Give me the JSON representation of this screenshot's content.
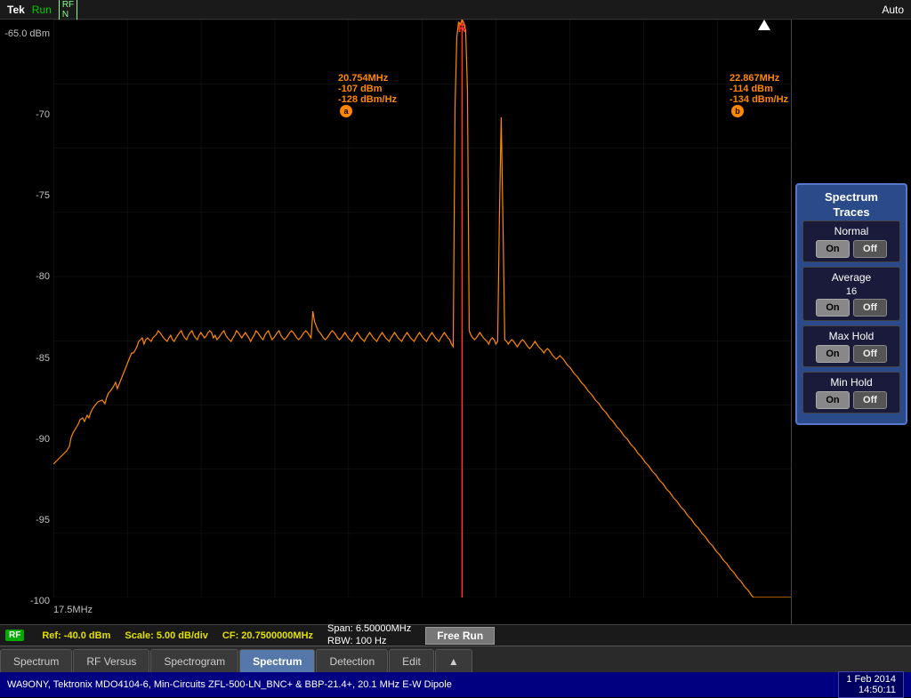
{
  "topBar": {
    "tek": "Tek",
    "run": "Run",
    "rf_n": "RF\nN",
    "auto": "Auto"
  },
  "chart": {
    "yLabels": [
      "-65.0 dBm",
      "-70",
      "-75",
      "-80",
      "-85",
      "-90",
      "-95",
      "-100"
    ],
    "xLabel": "17.5MHz",
    "markerA": {
      "freq": "20.754MHz",
      "power": "-107 dBm",
      "density": "-128 dBm/Hz",
      "label": "a"
    },
    "markerB": {
      "freq": "22.867MHz",
      "power": "-114 dBm",
      "density": "-134 dBm/Hz",
      "label": "b"
    }
  },
  "spectrumTraces": {
    "title1": "Spectrum",
    "title2": "Traces",
    "normal": {
      "label": "Normal",
      "on": "On",
      "off": "Off"
    },
    "average": {
      "label": "Average",
      "num": "16",
      "on": "On",
      "off": "Off"
    },
    "maxHold": {
      "label": "Max Hold",
      "on": "On",
      "off": "Off"
    },
    "minHold": {
      "label": "Min Hold",
      "on": "On",
      "off": "Off"
    }
  },
  "statusBar": {
    "rf": "RF",
    "ref": "Ref: -40.0 dBm",
    "scale": "Scale: 5.00 dB/div",
    "cf": "CF: 20.7500000MHz",
    "span": "Span:   6.50000MHz",
    "rbw": "RBW:    100 Hz",
    "freeRun": "Free Run"
  },
  "tabs": [
    {
      "label": "Spectrum",
      "active": false
    },
    {
      "label": "RF Versus",
      "active": false
    },
    {
      "label": "Spectrogram",
      "active": false
    },
    {
      "label": "Spectrum",
      "active": true
    },
    {
      "label": "Detection",
      "active": false
    },
    {
      "label": "Edit",
      "active": false
    }
  ],
  "bottomBar": {
    "text": "WA9ONY, Tektronix MDO4104-6, Min-Circuits ZFL-500-LN_BNC+ & BBP-21.4+, 20.1 MHz E-W Dipole",
    "date": "1 Feb 2014",
    "time": "14:50:11"
  }
}
